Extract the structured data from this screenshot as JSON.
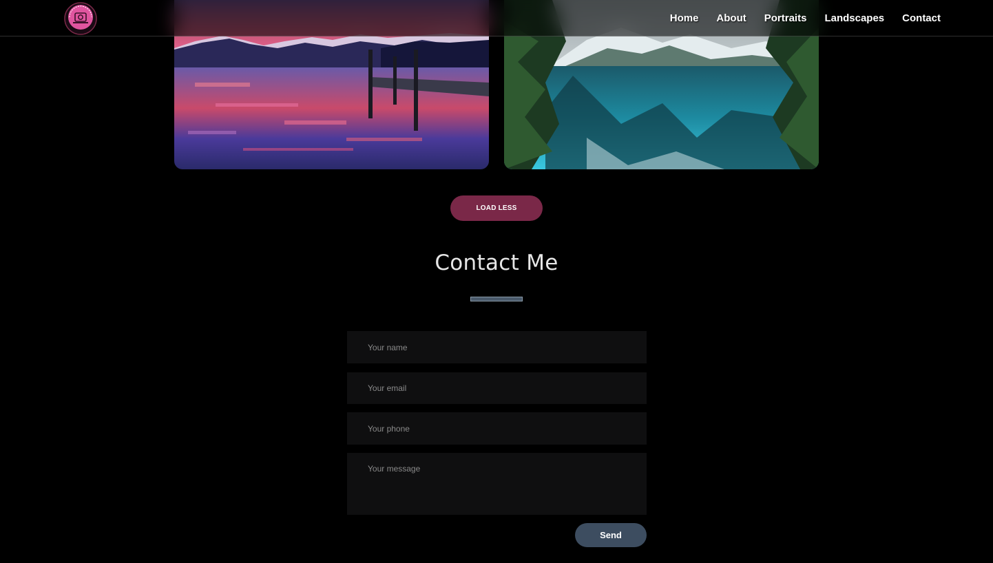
{
  "navbar": {
    "logo_text": "PHOTOGRAPHY",
    "links": [
      {
        "label": "Home"
      },
      {
        "label": "About"
      },
      {
        "label": "Portraits"
      },
      {
        "label": "Landscapes"
      },
      {
        "label": "Contact"
      }
    ]
  },
  "gallery": {
    "load_less_label": "LOAD LESS",
    "photos": [
      {
        "subject": "sunset lake with pier and mountains"
      },
      {
        "subject": "turquoise mountain lake with pine trees"
      }
    ]
  },
  "contact": {
    "title": "Contact Me",
    "fields": {
      "name_placeholder": "Your name",
      "email_placeholder": "Your email",
      "phone_placeholder": "Your phone",
      "message_placeholder": "Your message"
    },
    "send_label": "Send"
  },
  "colors": {
    "background": "#000000",
    "accent_button": "#7a2848",
    "send_button": "#3d4d60",
    "logo_pink": "#e0559f"
  }
}
